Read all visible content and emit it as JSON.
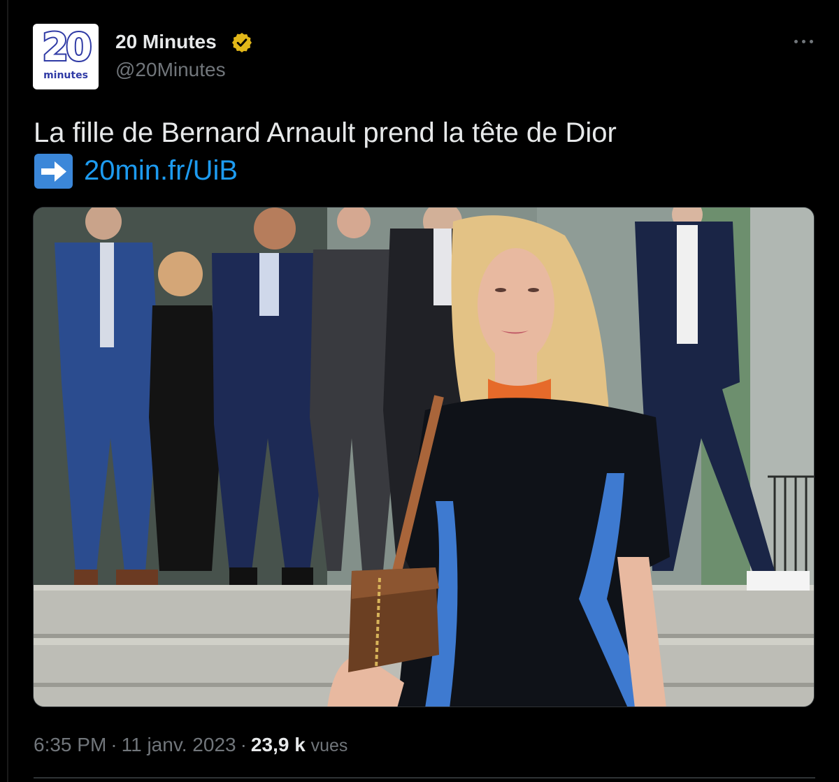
{
  "author": {
    "display_name": "20 Minutes",
    "handle": "@20Minutes",
    "verified": true,
    "avatar_number": "20",
    "avatar_word": "minutes",
    "avatar_color": "#2f3aa5"
  },
  "tweet": {
    "text": "La fille de Bernard Arnault prend la tête de Dior",
    "link_emoji": "arrow-right-icon",
    "link": "20min.fr/UiB"
  },
  "meta": {
    "time": "6:35 PM",
    "separator": "·",
    "date": "11 janv. 2023",
    "views_count": "23,9 k",
    "views_label": "vues"
  },
  "colors": {
    "background": "#000000",
    "text_primary": "#e7e9ea",
    "text_secondary": "#71767b",
    "link": "#1d9bf0",
    "verified_badge": "#e2b719"
  },
  "icons": {
    "verified": "verified-badge-icon",
    "more": "more-options-icon"
  }
}
